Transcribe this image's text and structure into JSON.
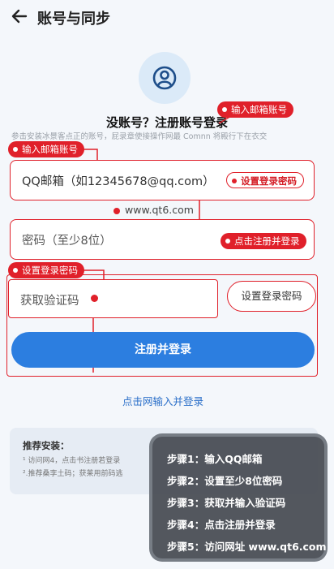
{
  "header": {
    "title": "账号与同步"
  },
  "intro": {
    "heading": "没账号？注册账号登录",
    "description": "参击安装冰景客点正的账号，屁录章使接操作网最 Comnn 将殿行下在衣交"
  },
  "form": {
    "email_value": "QQ邮箱（如12345678@qq.com）",
    "url_text": "www.qt6.com",
    "password_placeholder": "密码（至少8位）",
    "code_placeholder": "获取验证码",
    "code_button": "设置登录密码",
    "register_button": "注册并登录",
    "login_link": "点击网输入并登录"
  },
  "tags": {
    "email_top": "输入邮箱账号",
    "email_left": "输入邮箱账号",
    "set_password": "设置登录密码",
    "click_register": "点击注册并登录",
    "set_password_left": "设置登录密码"
  },
  "recommend": {
    "title": "推荐安装：",
    "line1": "¹ 访问网4，点击书注册若登录",
    "line2": "².推荐桑李土码；获莱用前码逃"
  },
  "steps": [
    "步骤1：输入QQ邮箱",
    "步骤2：设置至少8位密码",
    "步骤3：获取并输入验证码",
    "步骤4：点击注册并登录",
    "步骤5：访问网址 www.qt6.com"
  ],
  "colors": {
    "accent_red": "#e0202a",
    "primary_blue": "#2c7ee0",
    "avatar_bg": "#dbeaf8"
  },
  "icons": {
    "back": "arrow-left-icon",
    "avatar": "user-circle-icon"
  }
}
